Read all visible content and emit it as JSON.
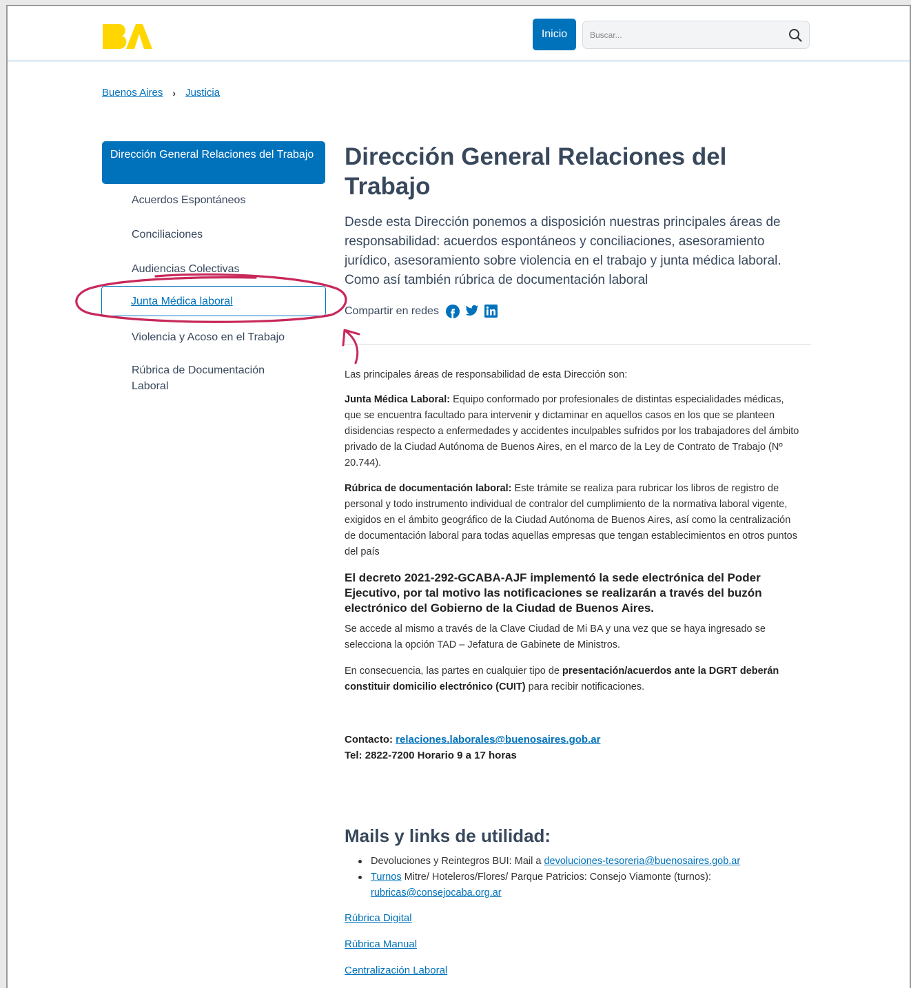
{
  "header": {
    "logo_text": "BA",
    "inicio_label": "Inicio",
    "search_placeholder": "Buscar..."
  },
  "breadcrumb": {
    "items": [
      "Buenos Aires",
      "Justicia"
    ],
    "separator": "›"
  },
  "sidebar": {
    "title": "Dirección General Relaciones del Trabajo",
    "items": [
      "Acuerdos Espontáneos",
      "Conciliaciones",
      "Audiencias Colectivas",
      "Junta Médica laboral",
      "Violencia y Acoso en el Trabajo",
      "Rúbrica de Documentación Laboral"
    ],
    "active_index": 3
  },
  "main": {
    "title": "Dirección General Relaciones del Trabajo",
    "intro": "Desde esta Dirección ponemos a disposición nuestras principales áreas de responsabilidad: acuerdos espontáneos y conciliaciones, asesoramiento jurídico, asesoramiento sobre violencia en el trabajo y junta médica laboral. Como así también rúbrica de documentación laboral",
    "share_label": "Compartir en redes",
    "share_icons": [
      "facebook-icon",
      "twitter-icon",
      "linkedin-icon"
    ],
    "areas_intro": "Las principales áreas de responsabilidad de esta Dirección son:",
    "junta_label": "Junta Médica Laboral:",
    "junta_text": " Equipo conformado por profesionales de distintas especialidades médicas, que se encuentra facultado para intervenir y dictaminar en aquellos casos en los que se planteen disidencias respecto a enfermedades y accidentes inculpables sufridos por los trabajadores del ámbito privado de la Ciudad Autónoma de Buenos Aires, en el marco de la Ley de Contrato de Trabajo (Nº 20.744).",
    "rubrica_label": "Rúbrica de documentación laboral:",
    "rubrica_text": " Este trámite se realiza para rubricar los libros de registro de personal y todo instrumento individual de contralor del cumplimiento de la normativa laboral vigente, exigidos en el ámbito geográfico de la Ciudad Autónoma de Buenos Aires, así como la centralización de documentación laboral para todas aquellas empresas que tengan establecimientos en otros puntos del país",
    "decreto": "El decreto 2021-292-GCABA-AJF implementó la sede electrónica del Poder Ejecutivo, por tal motivo las notificaciones se realizarán a través del buzón electrónico del Gobierno de la Ciudad de Buenos Aires.",
    "acceso": "Se accede al mismo a través de la Clave Ciudad de Mi BA y una vez que se haya ingresado se selecciona la opción TAD – Jefatura de Gabinete de Ministros.",
    "consecuencia_pre": "En consecuencia, las partes en cualquier tipo de ",
    "consecuencia_bold": "presentación/acuerdos ante la DGRT deberán constituir domicilio electrónico (CUIT)",
    "consecuencia_post": " para recibir notificaciones.",
    "contact_label": "Contacto: ",
    "contact_email": "relaciones.laborales@buenosaires.gob.ar",
    "contact_tel": "Tel: 2822-7200 Horario 9 a 17 horas"
  },
  "mails": {
    "title": "Mails y links de utilidad:",
    "item1_text": "Devoluciones y Reintegros BUI: Mail a ",
    "item1_link": "devoluciones-tesoreria@buenosaires.gob.ar",
    "item2_link": "Turnos",
    "item2_text": " Mitre/ Hoteleros/Flores/ Parque Patricios: Consejo Viamonte (turnos): ",
    "item2_email": "rubricas@consejocaba.org.ar",
    "links": [
      "Rúbrica Digital",
      "Rúbrica Manual",
      "Centralización Laboral"
    ]
  },
  "colors": {
    "primary": "#0072bb",
    "logo": "#ffd600",
    "annotation": "#c8285a",
    "heading": "#38485c"
  }
}
